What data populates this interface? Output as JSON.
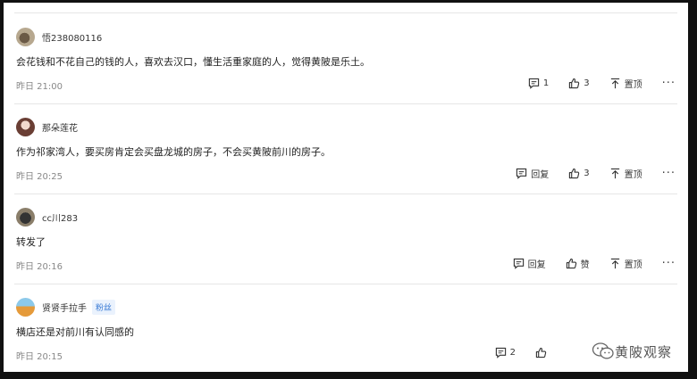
{
  "comments": [
    {
      "username": "悟238080116",
      "badge": "",
      "text": "会花钱和不花自己的钱的人，喜欢去汉口，懂生活重家庭的人，觉得黄陂是乐土。",
      "time": "昨日 21:00",
      "reply_label": "1",
      "like_label": "3",
      "pin_label": "置顶"
    },
    {
      "username": "那朵莲花",
      "badge": "",
      "text": "作为祁家湾人，要买房肯定会买盘龙城的房子，不会买黄陂前川的房子。",
      "time": "昨日 20:25",
      "reply_label": "回复",
      "like_label": "3",
      "pin_label": "置顶"
    },
    {
      "username": "cc川283",
      "badge": "",
      "text": "转发了",
      "time": "昨日 20:16",
      "reply_label": "回复",
      "like_label": "赞",
      "pin_label": "置顶"
    },
    {
      "username": "贤贤手拉手",
      "badge": "粉丝",
      "text": "横店还是对前川有认同感的",
      "time": "昨日 20:15",
      "reply_label": "2",
      "like_label": "",
      "pin_label": ""
    }
  ],
  "more_label": "···",
  "watermark": "黄陂观察",
  "icons": [
    "comment-icon",
    "thumb-up-icon",
    "pin-top-icon",
    "more-icon",
    "wechat-icon"
  ]
}
